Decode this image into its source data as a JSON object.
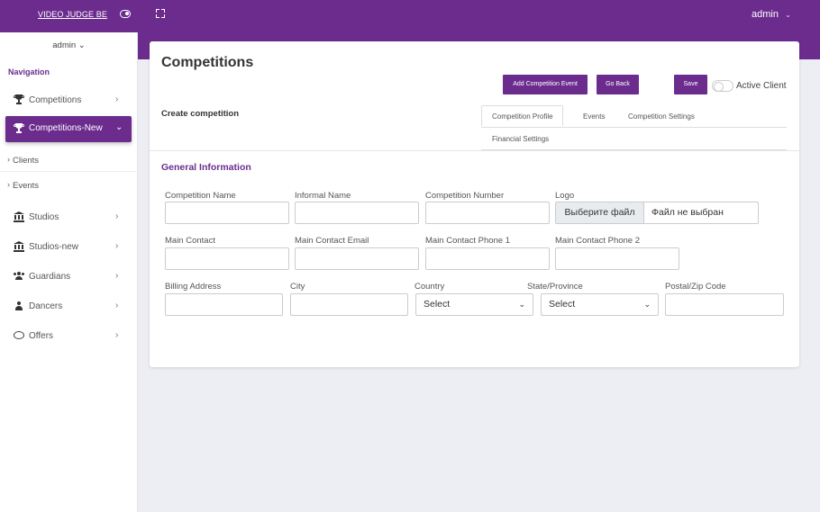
{
  "topbar": {
    "brand": "VIDEO JUDGE BE",
    "user": "admin",
    "user_chevron": "⌄"
  },
  "sidebar": {
    "user": "admin  ⌄",
    "heading": "Navigation",
    "items": [
      {
        "label": "Competitions",
        "icon": "trophy-icon",
        "chevron": "›"
      },
      {
        "label": "Competitions-New",
        "icon": "trophy-icon",
        "chevron": "⌄",
        "active": true
      },
      {
        "label": "Clients"
      },
      {
        "label": "Events"
      },
      {
        "label": "Studios",
        "icon": "bank-icon",
        "chevron": "›"
      },
      {
        "label": "Studios-new",
        "icon": "bank-icon",
        "chevron": "›"
      },
      {
        "label": "Guardians",
        "icon": "users-icon",
        "chevron": "›"
      },
      {
        "label": "Dancers",
        "icon": "user-icon",
        "chevron": "›"
      },
      {
        "label": "Offers",
        "icon": "chat-bubble-icon",
        "chevron": "›"
      }
    ]
  },
  "main": {
    "title": "Competitions",
    "subtitle": "Create competition",
    "buttons": {
      "add_event": "Add Competition Event",
      "go_back": "Go Back",
      "save": "Save"
    },
    "active_client_label": "Active Client",
    "tabs": [
      {
        "label": "Competition Profile",
        "active": true
      },
      {
        "label": "Events"
      },
      {
        "label": "Competition Settings"
      },
      {
        "label": "Financial Settings"
      }
    ],
    "section_title": "General Information",
    "fields": {
      "competition_name": {
        "label": "Competition Name",
        "value": ""
      },
      "informal_name": {
        "label": "Informal Name",
        "value": ""
      },
      "competition_number": {
        "label": "Competition Number",
        "value": ""
      },
      "logo": {
        "label": "Logo",
        "button": "Выберите файл",
        "text": "Файл не выбран"
      },
      "main_contact": {
        "label": "Main Contact",
        "value": ""
      },
      "main_contact_email": {
        "label": "Main Contact Email",
        "value": ""
      },
      "main_contact_phone1": {
        "label": "Main Contact Phone 1",
        "value": ""
      },
      "main_contact_phone2": {
        "label": "Main Contact Phone 2",
        "value": ""
      },
      "billing_address": {
        "label": "Billing Address",
        "value": ""
      },
      "city": {
        "label": "City",
        "value": ""
      },
      "country": {
        "label": "Country",
        "selected": "Select"
      },
      "state": {
        "label": "State/Province",
        "selected": "Select"
      },
      "postal": {
        "label": "Postal/Zip Code",
        "value": ""
      }
    }
  },
  "colors": {
    "primary": "#6b2c8e",
    "background": "#eceef3"
  }
}
